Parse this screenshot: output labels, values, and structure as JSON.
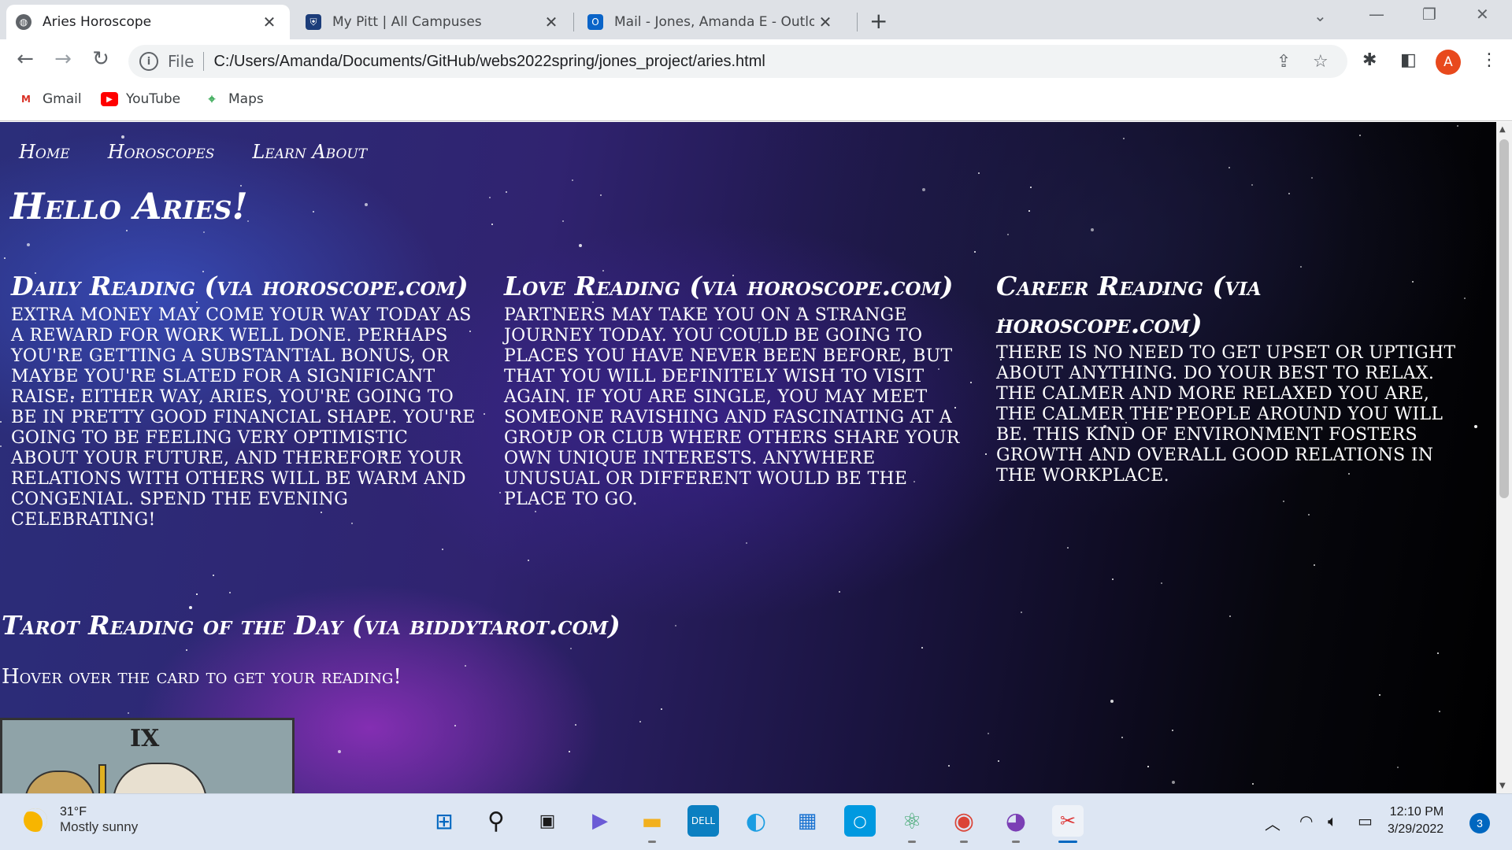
{
  "browser": {
    "tabs": [
      {
        "title": "Aries Horoscope",
        "icon": "globe-icon",
        "active": true
      },
      {
        "title": "My Pitt | All Campuses",
        "icon": "pitt-shield-icon",
        "active": false
      },
      {
        "title": "Mail - Jones, Amanda E - Outlook",
        "icon": "outlook-icon",
        "active": false
      }
    ],
    "address": {
      "scheme": "File",
      "url": "C:/Users/Amanda/Documents/GitHub/webs2022spring/jones_project/aries.html"
    },
    "profile_initial": "A",
    "bookmarks": [
      {
        "label": "Gmail",
        "icon": "gmail-icon"
      },
      {
        "label": "YouTube",
        "icon": "youtube-icon"
      },
      {
        "label": "Maps",
        "icon": "maps-icon"
      }
    ]
  },
  "page": {
    "nav": [
      "Home",
      "Horoscopes",
      "Learn About"
    ],
    "greeting": "Hello Aries!",
    "readings": [
      {
        "heading": "Daily Reading (via horoscope.com)",
        "text": "Extra money may come your way today as a reward for work well done. Perhaps you're getting a substantial bonus, or maybe you're slated for a significant raise. Either way, Aries, you're going to be in pretty good financial shape. You're going to be feeling very optimistic about your future, and therefore your relations with others will be warm and congenial. Spend the evening celebrating!"
      },
      {
        "heading": "Love Reading (via horoscope.com)",
        "text": "Partners may take you on a strange journey today. You could be going to places you have never been before, but that you will definitely wish to visit again. If you are single, you may meet someone ravishing and fascinating at a group or club where others share your own unique interests. Anywhere unusual or different would be the place to go."
      },
      {
        "heading": "Career Reading (via horoscope.com)",
        "text": "There is no need to get upset or uptight about anything. Do your best to relax. The calmer and more relaxed you are, the calmer the people around you will be. This kind of environment fosters growth and overall good relations in the workplace."
      }
    ],
    "tarot": {
      "heading": "Tarot Reading of the Day (via biddytarot.com)",
      "instruction": "Hover over the card to get your reading!",
      "card_numeral": "IX"
    }
  },
  "taskbar": {
    "weather": {
      "temp": "31°F",
      "condition": "Mostly sunny"
    },
    "apps": [
      "start-icon",
      "search-icon",
      "task-view-icon",
      "chat-icon",
      "file-explorer-icon",
      "dell-icon",
      "edge-icon",
      "store-icon",
      "cortana-icon",
      "atom-icon",
      "chrome-icon",
      "github-desktop-icon",
      "snipping-tool-icon"
    ],
    "time": "12:10 PM",
    "date": "3/29/2022",
    "notifications": "3"
  },
  "colors": {
    "tabstrip": "#dee1e6",
    "accent": "#0067c0",
    "avatar": "#e8491d",
    "taskbar": "#dde6f3"
  }
}
